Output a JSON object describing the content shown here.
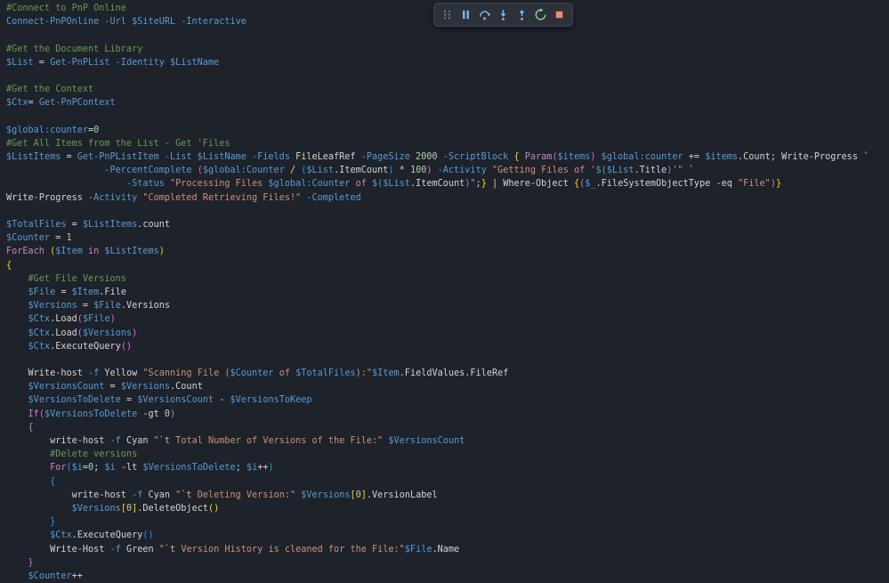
{
  "editor": {
    "background": "#1e222a",
    "palette": {
      "cm": "#6a9955",
      "bl": "#569cd6",
      "pl": "#d4d4d4",
      "st": "#ce9178",
      "nu": "#b5cea8",
      "kw": "#c586c0",
      "es": "#d7ba7d",
      "b1": "#ffd700",
      "b2": "#da70d6",
      "b3": "#179fff"
    },
    "lines": [
      [
        [
          "cm",
          "#Connect to PnP Online"
        ]
      ],
      [
        [
          "bl",
          "Connect-PnPOnline -Url $SiteURL -Interactive"
        ]
      ],
      [],
      [
        [
          "cm",
          "#Get the Document Library"
        ]
      ],
      [
        [
          "bl",
          "$List"
        ],
        [
          "pl",
          " = "
        ],
        [
          "bl",
          "Get-PnPList -Identity $ListName"
        ]
      ],
      [],
      [
        [
          "cm",
          "#Get the Context"
        ]
      ],
      [
        [
          "bl",
          "$Ctx"
        ],
        [
          "pl",
          "= "
        ],
        [
          "bl",
          "Get-PnPContext"
        ]
      ],
      [],
      [
        [
          "bl",
          "$global:counter"
        ],
        [
          "pl",
          "="
        ],
        [
          "nu",
          "0"
        ]
      ],
      [
        [
          "cm",
          "#Get All Items from the List - Get 'Files"
        ]
      ],
      [
        [
          "bl",
          "$ListItems"
        ],
        [
          "pl",
          " = "
        ],
        [
          "bl",
          "Get-PnPListItem -List $ListName -Fields "
        ],
        [
          "pl",
          "FileLeafRef"
        ],
        [
          "bl",
          " -PageSize "
        ],
        [
          "nu",
          "2000"
        ],
        [
          "bl",
          " -ScriptBlock "
        ],
        [
          "b1",
          "{"
        ],
        [
          "pl",
          " "
        ],
        [
          "kw",
          "Param"
        ],
        [
          "b2",
          "("
        ],
        [
          "bl",
          "$items"
        ],
        [
          "b2",
          ")"
        ],
        [
          "pl",
          " "
        ],
        [
          "bl",
          "$global:counter"
        ],
        [
          "pl",
          " += "
        ],
        [
          "bl",
          "$items"
        ],
        [
          "pl",
          ".Count; Write-Progress `"
        ]
      ],
      [
        [
          "pl",
          "                  "
        ],
        [
          "bl",
          "-PercentComplete "
        ],
        [
          "b2",
          "("
        ],
        [
          "bl",
          "$global:Counter"
        ],
        [
          "pl",
          " / "
        ],
        [
          "b3",
          "("
        ],
        [
          "bl",
          "$List"
        ],
        [
          "pl",
          ".ItemCount"
        ],
        [
          "b3",
          ")"
        ],
        [
          "pl",
          " * "
        ],
        [
          "nu",
          "100"
        ],
        [
          "b2",
          ")"
        ],
        [
          "bl",
          " -Activity "
        ],
        [
          "st",
          "\"Getting Files of '"
        ],
        [
          "bl",
          "$($List"
        ],
        [
          "pl",
          ".Title"
        ],
        [
          "bl",
          ")"
        ],
        [
          "st",
          "'\""
        ],
        [
          "pl",
          " `"
        ]
      ],
      [
        [
          "pl",
          "                      "
        ],
        [
          "bl",
          "-Status "
        ],
        [
          "st",
          "\"Processing Files "
        ],
        [
          "bl",
          "$global:Counter"
        ],
        [
          "st",
          " of "
        ],
        [
          "bl",
          "$($List"
        ],
        [
          "pl",
          ".ItemCount"
        ],
        [
          "bl",
          ")"
        ],
        [
          "st",
          "\""
        ],
        [
          "pl",
          ";"
        ],
        [
          "b1",
          "}"
        ],
        [
          "pl",
          " | Where-Object "
        ],
        [
          "b1",
          "{"
        ],
        [
          "b2",
          "("
        ],
        [
          "bl",
          "$_"
        ],
        [
          "pl",
          ".FileSystemObjectType -eq "
        ],
        [
          "st",
          "\"File\""
        ],
        [
          "b2",
          ")"
        ],
        [
          "b1",
          "}"
        ]
      ],
      [
        [
          "pl",
          "Write-Progress "
        ],
        [
          "bl",
          "-Activity "
        ],
        [
          "st",
          "\"Completed Retrieving Files!\""
        ],
        [
          "bl",
          " -Completed"
        ]
      ],
      [],
      [
        [
          "bl",
          "$TotalFiles"
        ],
        [
          "pl",
          " = "
        ],
        [
          "bl",
          "$ListItems"
        ],
        [
          "pl",
          ".count"
        ]
      ],
      [
        [
          "bl",
          "$Counter"
        ],
        [
          "pl",
          " = "
        ],
        [
          "nu",
          "1"
        ]
      ],
      [
        [
          "kw",
          "ForEach "
        ],
        [
          "b1",
          "("
        ],
        [
          "bl",
          "$Item"
        ],
        [
          "kw",
          " in "
        ],
        [
          "bl",
          "$ListItems"
        ],
        [
          "b1",
          ")"
        ]
      ],
      [
        [
          "b1",
          "{"
        ]
      ],
      [
        [
          "cm",
          "    #Get File Versions"
        ]
      ],
      [
        [
          "pl",
          "    "
        ],
        [
          "bl",
          "$File"
        ],
        [
          "pl",
          " = "
        ],
        [
          "bl",
          "$Item"
        ],
        [
          "pl",
          ".File"
        ]
      ],
      [
        [
          "pl",
          "    "
        ],
        [
          "bl",
          "$Versions"
        ],
        [
          "pl",
          " = "
        ],
        [
          "bl",
          "$File"
        ],
        [
          "pl",
          ".Versions"
        ]
      ],
      [
        [
          "pl",
          "    "
        ],
        [
          "bl",
          "$Ctx"
        ],
        [
          "pl",
          ".Load"
        ],
        [
          "b2",
          "("
        ],
        [
          "bl",
          "$File"
        ],
        [
          "b2",
          ")"
        ]
      ],
      [
        [
          "pl",
          "    "
        ],
        [
          "bl",
          "$Ctx"
        ],
        [
          "pl",
          ".Load"
        ],
        [
          "b2",
          "("
        ],
        [
          "bl",
          "$Versions"
        ],
        [
          "b2",
          ")"
        ]
      ],
      [
        [
          "pl",
          "    "
        ],
        [
          "bl",
          "$Ctx"
        ],
        [
          "pl",
          ".ExecuteQuery"
        ],
        [
          "b2",
          "()"
        ]
      ],
      [],
      [
        [
          "pl",
          "    Write-host "
        ],
        [
          "bl",
          "-f "
        ],
        [
          "pl",
          "Yellow "
        ],
        [
          "st",
          "\"Scanning File ("
        ],
        [
          "bl",
          "$Counter"
        ],
        [
          "st",
          " of "
        ],
        [
          "bl",
          "$TotalFiles"
        ],
        [
          "st",
          "):\""
        ],
        [
          "bl",
          "$Item"
        ],
        [
          "pl",
          ".FieldValues.FileRef"
        ]
      ],
      [
        [
          "pl",
          "    "
        ],
        [
          "bl",
          "$VersionsCount"
        ],
        [
          "pl",
          " = "
        ],
        [
          "bl",
          "$Versions"
        ],
        [
          "pl",
          ".Count"
        ]
      ],
      [
        [
          "pl",
          "    "
        ],
        [
          "bl",
          "$VersionsToDelete"
        ],
        [
          "pl",
          " = "
        ],
        [
          "bl",
          "$VersionsCount"
        ],
        [
          "pl",
          " - "
        ],
        [
          "bl",
          "$VersionsToKeep"
        ]
      ],
      [
        [
          "pl",
          "    "
        ],
        [
          "kw",
          "If"
        ],
        [
          "b2",
          "("
        ],
        [
          "bl",
          "$VersionsToDelete"
        ],
        [
          "pl",
          " -gt "
        ],
        [
          "nu",
          "0"
        ],
        [
          "b2",
          ")"
        ]
      ],
      [
        [
          "pl",
          "    "
        ],
        [
          "b2",
          "{"
        ]
      ],
      [
        [
          "pl",
          "        write-host "
        ],
        [
          "bl",
          "-f "
        ],
        [
          "pl",
          "Cyan "
        ],
        [
          "st",
          "\""
        ],
        [
          "es",
          "`t"
        ],
        [
          "st",
          " Total Number of Versions of the File:\""
        ],
        [
          "pl",
          " "
        ],
        [
          "bl",
          "$VersionsCount"
        ]
      ],
      [
        [
          "cm",
          "        #Delete versions"
        ]
      ],
      [
        [
          "pl",
          "        "
        ],
        [
          "kw",
          "For"
        ],
        [
          "b3",
          "("
        ],
        [
          "bl",
          "$i"
        ],
        [
          "pl",
          "="
        ],
        [
          "nu",
          "0"
        ],
        [
          "pl",
          "; "
        ],
        [
          "bl",
          "$i"
        ],
        [
          "pl",
          " -lt "
        ],
        [
          "bl",
          "$VersionsToDelete"
        ],
        [
          "pl",
          "; "
        ],
        [
          "bl",
          "$i"
        ],
        [
          "pl",
          "++"
        ],
        [
          "b3",
          ")"
        ]
      ],
      [
        [
          "pl",
          "        "
        ],
        [
          "b3",
          "{"
        ]
      ],
      [
        [
          "pl",
          "            write-host "
        ],
        [
          "bl",
          "-f "
        ],
        [
          "pl",
          "Cyan "
        ],
        [
          "st",
          "\""
        ],
        [
          "es",
          "`t"
        ],
        [
          "st",
          " Deleting Version:\""
        ],
        [
          "pl",
          " "
        ],
        [
          "bl",
          "$Versions"
        ],
        [
          "b1",
          "["
        ],
        [
          "nu",
          "0"
        ],
        [
          "b1",
          "]"
        ],
        [
          "pl",
          ".VersionLabel"
        ]
      ],
      [
        [
          "pl",
          "            "
        ],
        [
          "bl",
          "$Versions"
        ],
        [
          "b1",
          "["
        ],
        [
          "nu",
          "0"
        ],
        [
          "b1",
          "]"
        ],
        [
          "pl",
          ".DeleteObject"
        ],
        [
          "b1",
          "()"
        ]
      ],
      [
        [
          "pl",
          "        "
        ],
        [
          "b3",
          "}"
        ]
      ],
      [
        [
          "pl",
          "        "
        ],
        [
          "bl",
          "$Ctx"
        ],
        [
          "pl",
          ".ExecuteQuery"
        ],
        [
          "b3",
          "()"
        ]
      ],
      [
        [
          "pl",
          "        Write-Host "
        ],
        [
          "bl",
          "-f "
        ],
        [
          "pl",
          "Green "
        ],
        [
          "st",
          "\""
        ],
        [
          "es",
          "`t"
        ],
        [
          "st",
          " Version History is cleaned for the File:\""
        ],
        [
          "bl",
          "$File"
        ],
        [
          "pl",
          ".Name"
        ]
      ],
      [
        [
          "pl",
          "    "
        ],
        [
          "b2",
          "}"
        ]
      ],
      [
        [
          "pl",
          "    "
        ],
        [
          "bl",
          "$Counter"
        ],
        [
          "pl",
          "++"
        ]
      ]
    ]
  },
  "debug_toolbar": {
    "background": "#2c313a",
    "border": "#40464f",
    "buttons": [
      {
        "name": "drag-handle-icon",
        "kind": "gripper",
        "color": "#7f8da0",
        "interactable": true
      },
      {
        "name": "pause-button",
        "kind": "pause",
        "color": "#75beff",
        "interactable": true
      },
      {
        "name": "step-over-button",
        "kind": "step-over",
        "color": "#75beff",
        "interactable": true
      },
      {
        "name": "step-into-button",
        "kind": "step-into",
        "color": "#75beff",
        "interactable": true
      },
      {
        "name": "step-out-button",
        "kind": "step-out",
        "color": "#75beff",
        "interactable": true
      },
      {
        "name": "restart-button",
        "kind": "restart",
        "color": "#89d185",
        "interactable": true
      },
      {
        "name": "stop-button",
        "kind": "stop",
        "color": "#f48771",
        "interactable": true
      }
    ]
  }
}
